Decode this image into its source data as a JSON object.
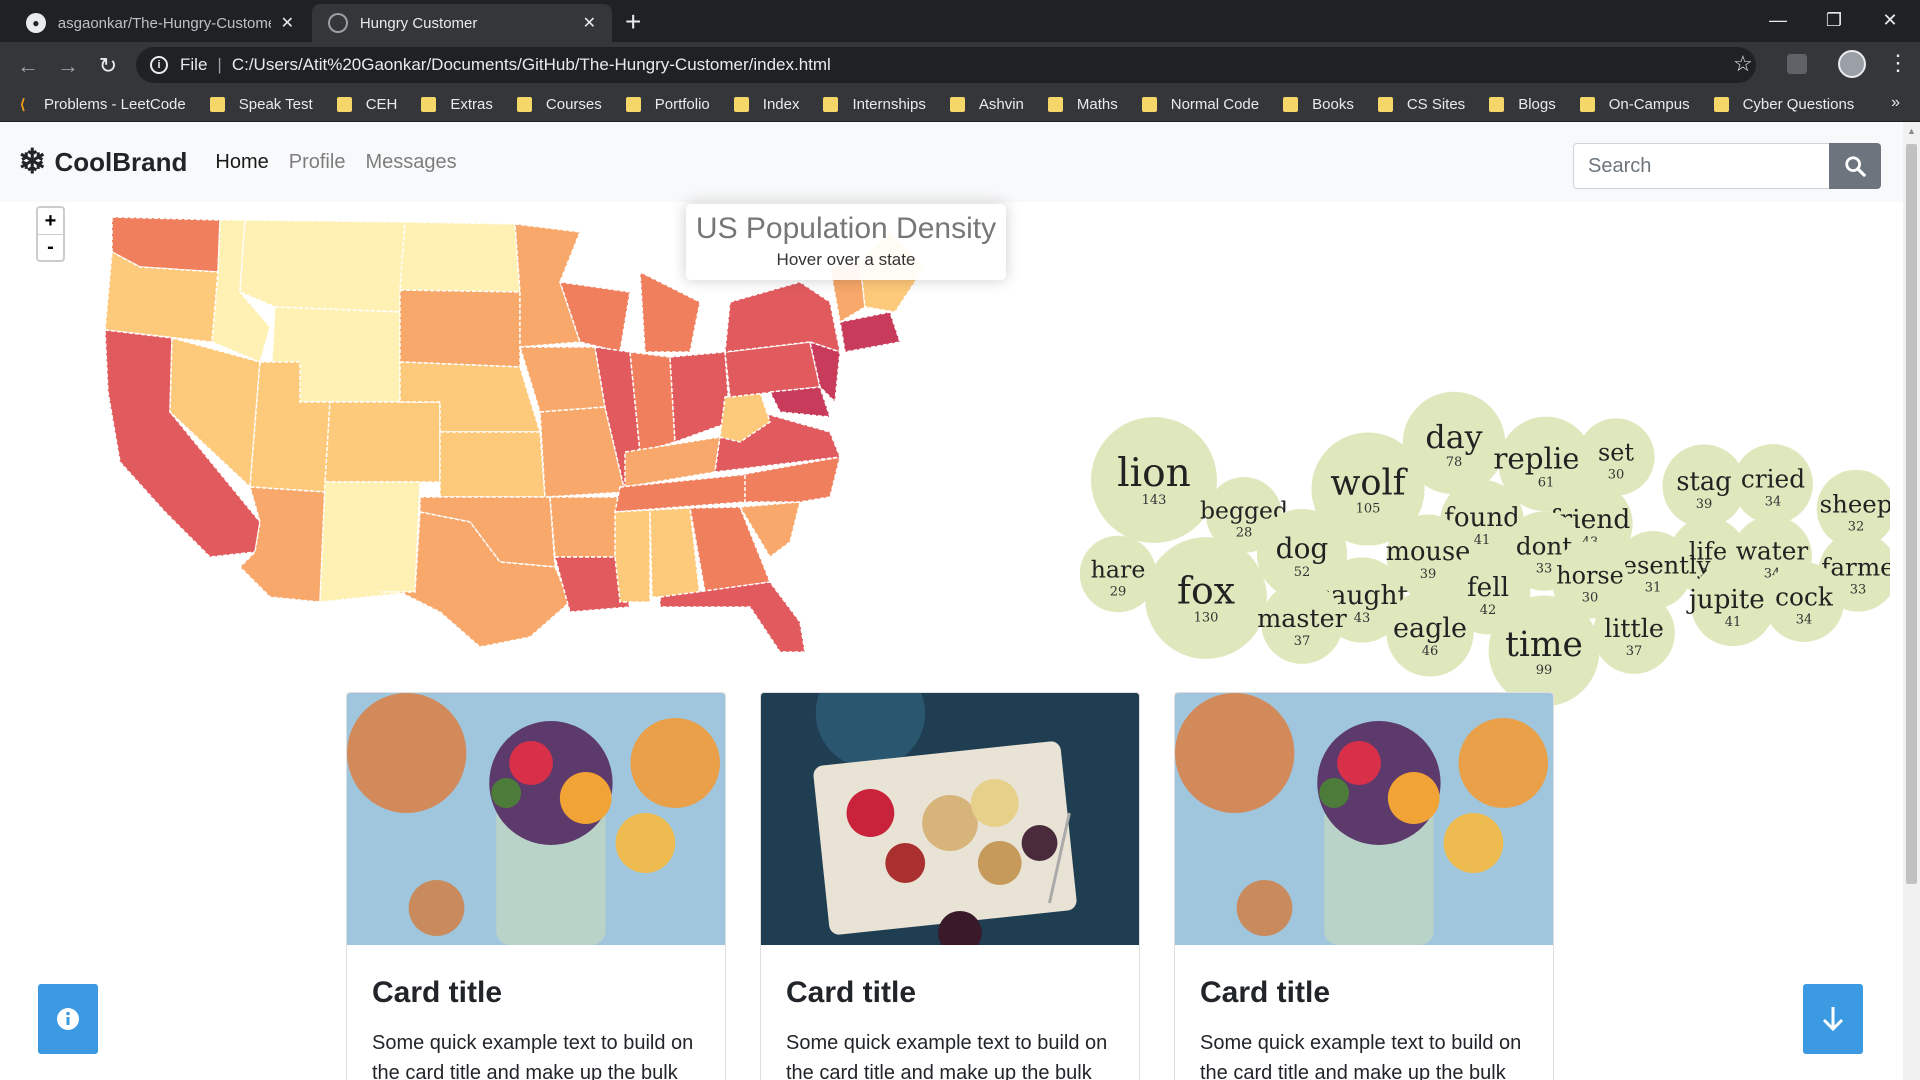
{
  "browser": {
    "tabs": [
      {
        "title": "asgaonkar/The-Hungry-Customer",
        "active": false
      },
      {
        "title": "Hungry Customer",
        "active": true
      }
    ],
    "url_scheme_label": "File",
    "url": "C:/Users/Atit%20Gaonkar/Documents/GitHub/The-Hungry-Customer/index.html",
    "bookmarks": [
      "Problems - LeetCode",
      "Speak Test",
      "CEH",
      "Extras",
      "Courses",
      "Portfolio",
      "Index",
      "Internships",
      "Ashvin",
      "Maths",
      "Normal Code",
      "Books",
      "CS Sites",
      "Blogs",
      "On-Campus",
      "Cyber Questions"
    ]
  },
  "navbar": {
    "brand": "CoolBrand",
    "links": [
      "Home",
      "Profile",
      "Messages"
    ],
    "search_placeholder": "Search"
  },
  "map": {
    "zoom_in": "+",
    "zoom_out": "-",
    "info_title": "US Population Density",
    "info_sub": "Hover over a state",
    "colors": {
      "low": "#fff0b3",
      "midlow": "#fdc97a",
      "mid": "#f7a86a",
      "midhigh": "#f07f5e",
      "high": "#e15b5e",
      "top": "#c93b5a"
    }
  },
  "word_bubbles": [
    {
      "word": "lion",
      "count": "143"
    },
    {
      "word": "begged",
      "count": "28"
    },
    {
      "word": "wolf",
      "count": "105"
    },
    {
      "word": "day",
      "count": "78"
    },
    {
      "word": "replied",
      "count": "61"
    },
    {
      "word": "set",
      "count": "30"
    },
    {
      "word": "stag",
      "count": "39"
    },
    {
      "word": "cried",
      "count": "34"
    },
    {
      "word": "sheep",
      "count": "32"
    },
    {
      "word": "hare",
      "count": "29"
    },
    {
      "word": "fox",
      "count": "130"
    },
    {
      "word": "dog",
      "count": "52"
    },
    {
      "word": "found",
      "count": "41"
    },
    {
      "word": "friend",
      "count": "43"
    },
    {
      "word": "dont",
      "count": "33"
    },
    {
      "word": "life",
      "count": "30"
    },
    {
      "word": "water",
      "count": "34"
    },
    {
      "word": "farme",
      "count": "33"
    },
    {
      "word": "mouse",
      "count": "39"
    },
    {
      "word": "presently",
      "count": "31"
    },
    {
      "word": "horse",
      "count": "30"
    },
    {
      "word": "caught",
      "count": "43"
    },
    {
      "word": "fell",
      "count": "42"
    },
    {
      "word": "master",
      "count": "37"
    },
    {
      "word": "eagle",
      "count": "46"
    },
    {
      "word": "time",
      "count": "99"
    },
    {
      "word": "little",
      "count": "37"
    },
    {
      "word": "jupiter",
      "count": "41"
    },
    {
      "word": "cock",
      "count": "34"
    }
  ],
  "cards": [
    {
      "title": "Card title",
      "text": "Some quick example text to build on the card title and make up the bulk"
    },
    {
      "title": "Card title",
      "text": "Some quick example text to build on the card title and make up the bulk"
    },
    {
      "title": "Card title",
      "text": "Some quick example text to build on the card title and make up the bulk"
    }
  ]
}
